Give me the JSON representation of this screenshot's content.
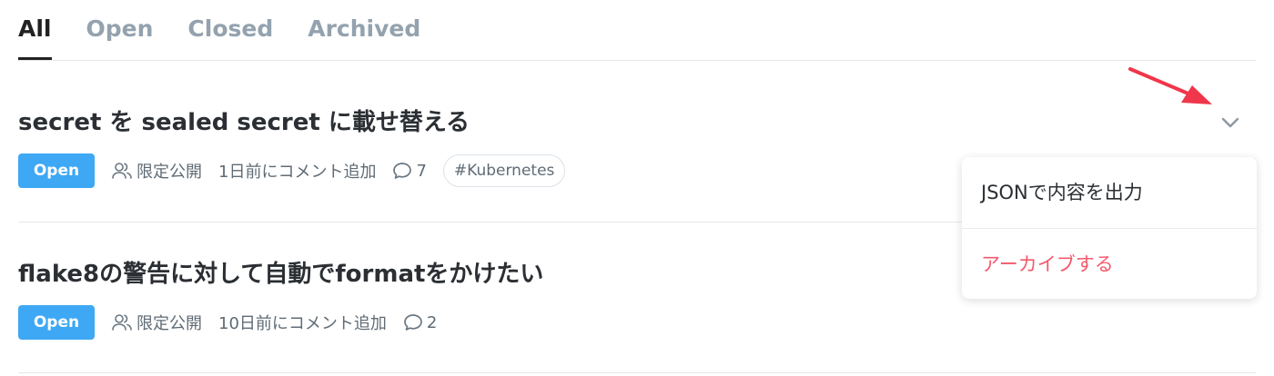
{
  "tabs": [
    {
      "label": "All",
      "active": true
    },
    {
      "label": "Open"
    },
    {
      "label": "Closed"
    },
    {
      "label": "Archived"
    }
  ],
  "issues": [
    {
      "title": "secret を sealed secret に載せ替える",
      "status": "Open",
      "visibility": "限定公開",
      "last_activity": "1日前にコメント追加",
      "comments": "7",
      "tag": "#Kubernetes"
    },
    {
      "title": "flake8の警告に対して自動でformatをかけたい",
      "status": "Open",
      "visibility": "限定公開",
      "last_activity": "10日前にコメント追加",
      "comments": "2"
    }
  ],
  "menu": {
    "items": [
      {
        "label": "JSONで内容を出力"
      },
      {
        "label": "アーカイブする",
        "danger": true
      }
    ]
  },
  "colors": {
    "status_open": "#3ea8f4",
    "danger": "#f3596b",
    "annotation_arrow": "#f0364a"
  },
  "icons": [
    "users-icon",
    "comment-icon",
    "chevron-down-icon",
    "annotation-arrow-icon"
  ]
}
